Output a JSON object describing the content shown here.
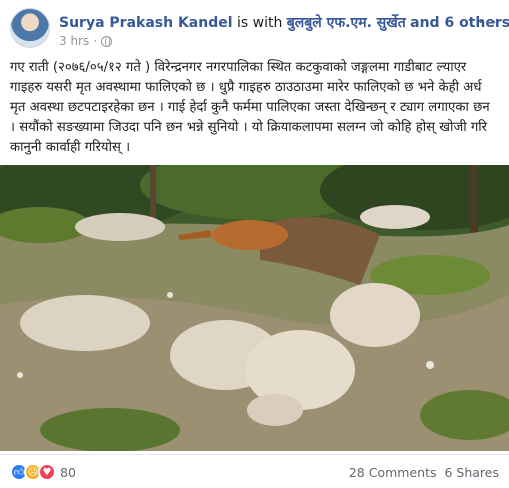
{
  "post": {
    "author": "Surya Prakash Kandel",
    "with_text": "is with",
    "with_target": "बुलबुले एफ.एम. सुर्खेत",
    "others_text": "and 6 others.",
    "timestamp": "3 hrs",
    "privacy_icon": "globe-icon",
    "menu_icon": "more-icon",
    "text": "गए राती (२०७६/०५/१२ गते ) विरेन्द्रनगर नगरपालिका स्थित कटकुवाको जङ्गलमा गाडीबाट ल्याएर गाइहरु यसरी मृत अवस्थामा फालिएको छ । धुप्रै गाइहरु ठाउठाउमा मारेर फालिएको छ भने केही अर्ध मृत अवस्था छटपटाइरहेका छन । गाई हेर्दा कुनै फर्ममा पालिएका जस्ता देखिन्छन् र ट्याग लगाएका छन । सयौंको सङख्यामा जिउदा पनि छन भन्ने सुनियो । यो क्रियाकलापमा सलग्न जो कोहि होस् खोजी गरि कानुनी कार्वाही गरियोस् ।"
  },
  "footer": {
    "reaction_icons": [
      "like-icon",
      "sad-icon",
      "love-icon"
    ],
    "reaction_count": "80",
    "comments": "28 Comments",
    "shares": "6 Shares"
  },
  "colors": {
    "link": "#385898",
    "muted": "#90949c",
    "like": "#2e7cf6",
    "sad": "#f7b125",
    "love": "#f33e58"
  }
}
